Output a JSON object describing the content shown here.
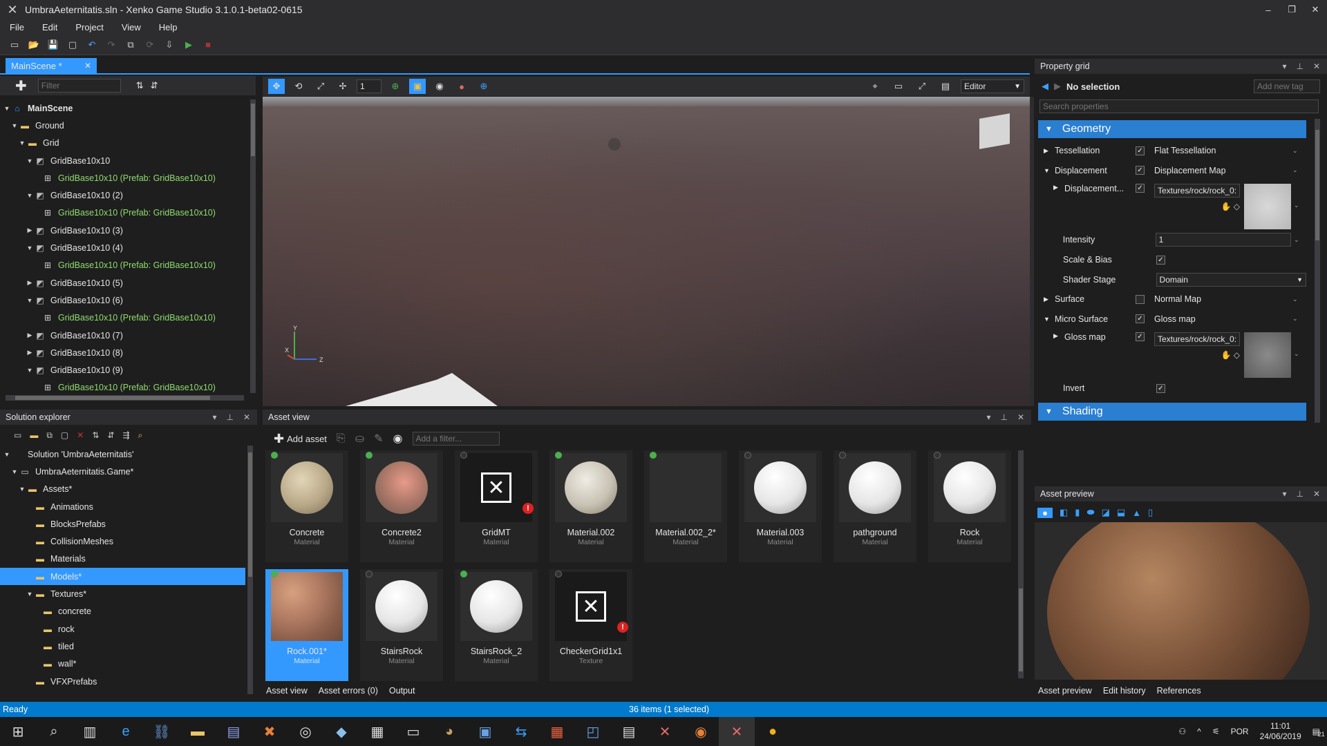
{
  "window": {
    "title": "UmbraAeternitatis.sln - Xenko Game Studio 3.1.0.1-beta02-0615"
  },
  "menu": [
    "File",
    "Edit",
    "Project",
    "View",
    "Help"
  ],
  "scene_tab": {
    "label": "MainScene *"
  },
  "scene_filter": {
    "placeholder": "Filter"
  },
  "scene_tree": [
    {
      "label": "MainScene",
      "depth": 0,
      "arrow": "▼",
      "icon": "scene-icon",
      "bold": true
    },
    {
      "label": "Ground",
      "depth": 1,
      "arrow": "▼",
      "icon": "folder-icon"
    },
    {
      "label": "Grid",
      "depth": 2,
      "arrow": "▼",
      "icon": "folder-icon"
    },
    {
      "label": "GridBase10x10",
      "depth": 3,
      "arrow": "▼",
      "icon": "entity-icon"
    },
    {
      "label": "GridBase10x10 (Prefab: GridBase10x10)",
      "depth": 4,
      "arrow": "",
      "icon": "prefab-icon",
      "green": true
    },
    {
      "label": "GridBase10x10 (2)",
      "depth": 3,
      "arrow": "▼",
      "icon": "entity-icon"
    },
    {
      "label": "GridBase10x10 (Prefab: GridBase10x10)",
      "depth": 4,
      "arrow": "",
      "icon": "prefab-icon",
      "green": true
    },
    {
      "label": "GridBase10x10 (3)",
      "depth": 3,
      "arrow": "▶",
      "icon": "entity-icon"
    },
    {
      "label": "GridBase10x10 (4)",
      "depth": 3,
      "arrow": "▼",
      "icon": "entity-icon"
    },
    {
      "label": "GridBase10x10 (Prefab: GridBase10x10)",
      "depth": 4,
      "arrow": "",
      "icon": "prefab-icon",
      "green": true
    },
    {
      "label": "GridBase10x10 (5)",
      "depth": 3,
      "arrow": "▶",
      "icon": "entity-icon"
    },
    {
      "label": "GridBase10x10 (6)",
      "depth": 3,
      "arrow": "▼",
      "icon": "entity-icon"
    },
    {
      "label": "GridBase10x10 (Prefab: GridBase10x10)",
      "depth": 4,
      "arrow": "",
      "icon": "prefab-icon",
      "green": true
    },
    {
      "label": "GridBase10x10 (7)",
      "depth": 3,
      "arrow": "▶",
      "icon": "entity-icon"
    },
    {
      "label": "GridBase10x10 (8)",
      "depth": 3,
      "arrow": "▶",
      "icon": "entity-icon"
    },
    {
      "label": "GridBase10x10 (9)",
      "depth": 3,
      "arrow": "▼",
      "icon": "entity-icon"
    },
    {
      "label": "GridBase10x10 (Prefab: GridBase10x10)",
      "depth": 4,
      "arrow": "",
      "icon": "prefab-icon",
      "green": true
    }
  ],
  "viewport": {
    "gizmo_step": "1",
    "mode": "Editor"
  },
  "solution_explorer": {
    "title": "Solution explorer",
    "items": [
      {
        "label": "Solution 'UmbraAeternitatis'",
        "depth": 0,
        "arrow": "▼",
        "icon": "solution-icon"
      },
      {
        "label": "UmbraAeternitatis.Game*",
        "depth": 1,
        "arrow": "▼",
        "icon": "project-icon"
      },
      {
        "label": "Assets*",
        "depth": 2,
        "arrow": "▼",
        "icon": "folder-icon"
      },
      {
        "label": "Animations",
        "depth": 3,
        "arrow": "",
        "icon": "folder-icon"
      },
      {
        "label": "BlocksPrefabs",
        "depth": 3,
        "arrow": "",
        "icon": "folder-icon"
      },
      {
        "label": "CollisionMeshes",
        "depth": 3,
        "arrow": "",
        "icon": "folder-icon"
      },
      {
        "label": "Materials",
        "depth": 3,
        "arrow": "",
        "icon": "folder-icon"
      },
      {
        "label": "Models*",
        "depth": 3,
        "arrow": "",
        "icon": "folder-icon",
        "selected": true
      },
      {
        "label": "Textures*",
        "depth": 3,
        "arrow": "▼",
        "icon": "folder-icon"
      },
      {
        "label": "concrete",
        "depth": 4,
        "arrow": "",
        "icon": "folder-icon"
      },
      {
        "label": "rock",
        "depth": 4,
        "arrow": "",
        "icon": "folder-icon"
      },
      {
        "label": "tiled",
        "depth": 4,
        "arrow": "",
        "icon": "folder-icon"
      },
      {
        "label": "wall*",
        "depth": 4,
        "arrow": "",
        "icon": "folder-icon"
      },
      {
        "label": "VFXPrefabs",
        "depth": 3,
        "arrow": "",
        "icon": "folder-icon"
      }
    ]
  },
  "asset_view": {
    "title": "Asset view",
    "add_asset": "Add asset",
    "filter_placeholder": "Add a filter...",
    "assets": [
      {
        "name": "Concrete",
        "type": "Material",
        "dot": "green",
        "preview": "concrete"
      },
      {
        "name": "Concrete2",
        "type": "Material",
        "dot": "green",
        "preview": "concrete2"
      },
      {
        "name": "GridMT",
        "type": "Material",
        "dot": "grey",
        "preview": "missing",
        "error": true
      },
      {
        "name": "Material.002",
        "type": "Material",
        "dot": "green",
        "preview": "tiles"
      },
      {
        "name": "Material.002_2*",
        "type": "Material",
        "dot": "green",
        "preview": "blank"
      },
      {
        "name": "Material.003",
        "type": "Material",
        "dot": "grey",
        "preview": "white"
      },
      {
        "name": "pathground",
        "type": "Material",
        "dot": "grey",
        "preview": "white"
      },
      {
        "name": "Rock",
        "type": "Material",
        "dot": "grey",
        "preview": "white"
      },
      {
        "name": "Rock.001*",
        "type": "Material",
        "dot": "green",
        "preview": "rock",
        "selected": true
      },
      {
        "name": "StairsRock",
        "type": "Material",
        "dot": "grey",
        "preview": "white"
      },
      {
        "name": "StairsRock_2",
        "type": "Material",
        "dot": "green",
        "preview": "white"
      },
      {
        "name": "CheckerGrid1x1",
        "type": "Texture",
        "dot": "grey",
        "preview": "missing",
        "error": true
      }
    ],
    "bottom_tabs": [
      "Asset view",
      "Asset errors (0)",
      "Output"
    ]
  },
  "property_grid": {
    "title": "Property grid",
    "selection": "No selection",
    "add_tag_placeholder": "Add new tag",
    "search_placeholder": "Search properties",
    "geometry_label": "Geometry",
    "shading_label": "Shading",
    "rows": {
      "tessellation": {
        "label": "Tessellation",
        "value": "Flat Tessellation"
      },
      "displacement": {
        "label": "Displacement",
        "value": "Displacement Map"
      },
      "displacement_map": {
        "label": "Displacement...",
        "value": "Textures/rock/rock_0:"
      },
      "intensity": {
        "label": "Intensity",
        "value": "1"
      },
      "scale_bias": {
        "label": "Scale & Bias"
      },
      "shader_stage": {
        "label": "Shader Stage",
        "value": "Domain"
      },
      "surface": {
        "label": "Surface",
        "value": "Normal Map"
      },
      "micro_surface": {
        "label": "Micro Surface",
        "value": "Gloss map"
      },
      "gloss_map": {
        "label": "Gloss map",
        "value": "Textures/rock/rock_0:"
      },
      "invert": {
        "label": "Invert"
      }
    }
  },
  "asset_preview": {
    "title": "Asset preview",
    "tabs": [
      "Asset preview",
      "Edit history",
      "References"
    ]
  },
  "status": {
    "left": "Ready",
    "center": "36 items (1 selected)"
  },
  "taskbar": {
    "lang": "POR",
    "time": "11:01",
    "date": "24/06/2019",
    "notif_count": "21"
  }
}
